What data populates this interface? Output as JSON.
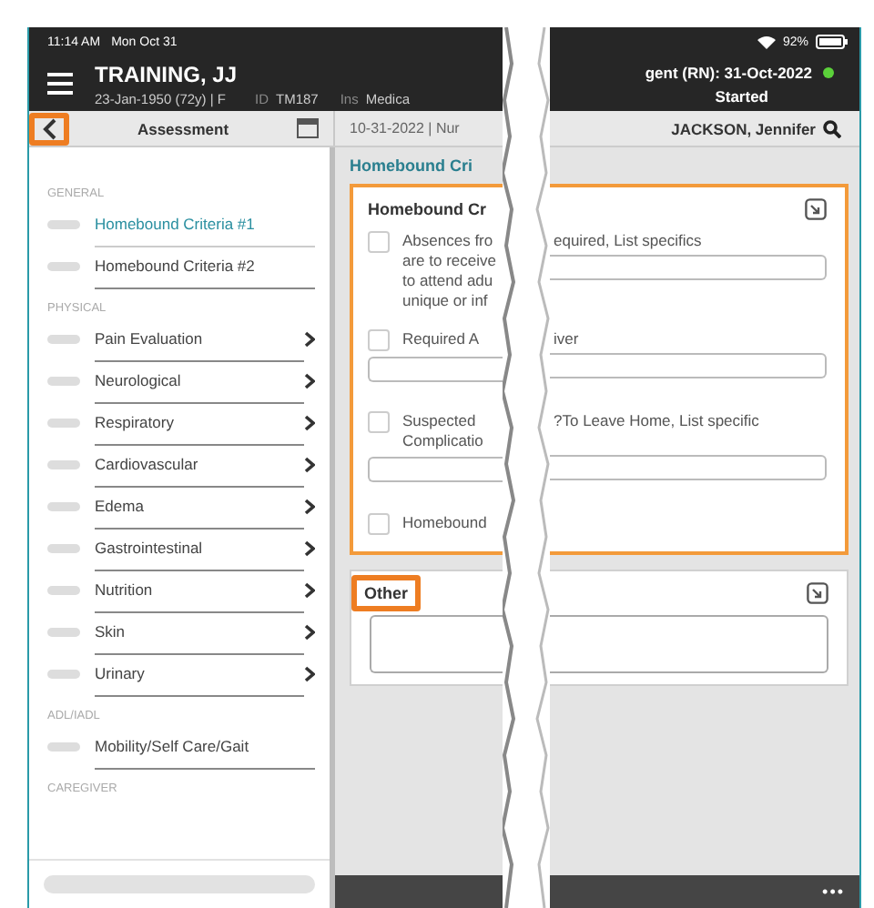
{
  "status_bar": {
    "time": "11:14 AM",
    "date": "Mon Oct 31",
    "battery": "92%"
  },
  "patient": {
    "name": "TRAINING, JJ",
    "dob": "23-Jan-1950 (72y) | F",
    "id_label": "ID",
    "id": "TM187",
    "ins_label": "Ins",
    "ins": "Medica"
  },
  "visit": {
    "label": "gent (RN): 31-Oct-2022",
    "status": "Started"
  },
  "sidebar": {
    "title": "Assessment",
    "back_highlighted": true,
    "sections": [
      {
        "label": "GENERAL",
        "items": [
          {
            "label": "Homebound Criteria #1",
            "selected": true,
            "submenu": false
          },
          {
            "label": "Homebound Criteria #2",
            "selected": false,
            "submenu": false
          }
        ]
      },
      {
        "label": "PHYSICAL",
        "items": [
          {
            "label": "Pain Evaluation",
            "selected": false,
            "submenu": true
          },
          {
            "label": "Neurological",
            "selected": false,
            "submenu": true
          },
          {
            "label": "Respiratory",
            "selected": false,
            "submenu": true
          },
          {
            "label": "Cardiovascular",
            "selected": false,
            "submenu": true
          },
          {
            "label": "Edema",
            "selected": false,
            "submenu": true
          },
          {
            "label": "Gastrointestinal",
            "selected": false,
            "submenu": true
          },
          {
            "label": "Nutrition",
            "selected": false,
            "submenu": true
          },
          {
            "label": "Skin",
            "selected": false,
            "submenu": true
          },
          {
            "label": "Urinary",
            "selected": false,
            "submenu": true
          }
        ]
      },
      {
        "label": "ADL/IADL",
        "items": [
          {
            "label": "Mobility/Self Care/Gait",
            "selected": false,
            "submenu": false
          }
        ]
      },
      {
        "label": "CAREGIVER"
      }
    ]
  },
  "main": {
    "date_line": "10-31-2022 | Nur",
    "clinician": "JACKSON, Jennifer",
    "section_title": "Homebound Cri",
    "card": {
      "title": "Homebound Cr",
      "highlighted": true,
      "items": [
        {
          "kind": "inline_field",
          "checked": false,
          "left": [
            "Absences fro",
            "are to receive",
            "to attend adu",
            "unique or inf"
          ],
          "right": "equired, List specifics"
        },
        {
          "kind": "field_below",
          "checked": false,
          "left": [
            "Required A"
          ],
          "right": "iver"
        },
        {
          "kind": "field_below",
          "checked": false,
          "left": [
            "Suspected",
            "Complicatio"
          ],
          "right": "?To Leave Home, List specific"
        },
        {
          "kind": "plain",
          "checked": false,
          "left": [
            "Homebound"
          ]
        }
      ]
    },
    "other": {
      "title": "Other",
      "highlighted": true
    },
    "more": "•••"
  }
}
